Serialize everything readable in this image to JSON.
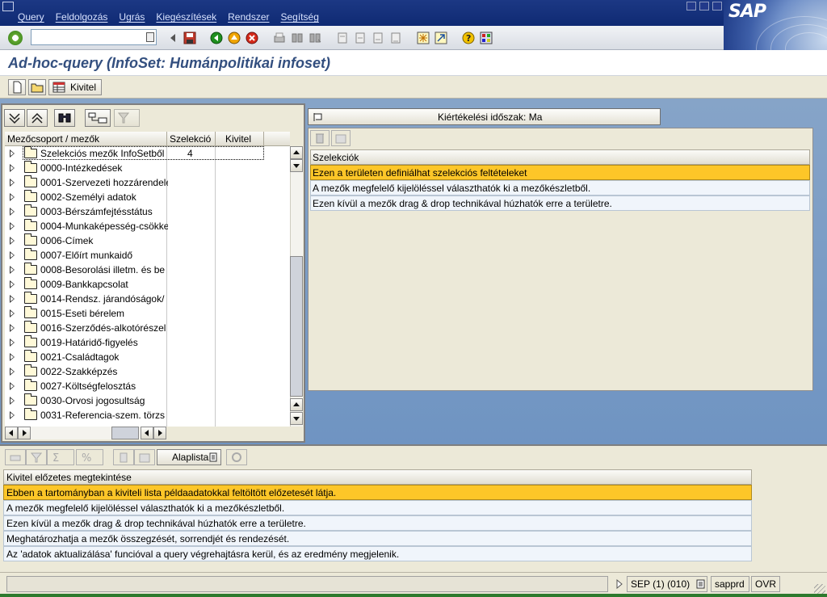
{
  "menubar": {
    "items": [
      "Query",
      "Feldolgozás",
      "Ugrás",
      "Kiegészítések",
      "Rendszer",
      "Segítség"
    ],
    "logo": "SAP"
  },
  "toolbar": {
    "command_field_value": "",
    "icons": [
      "enter-icon",
      "back-icon",
      "save-icon",
      "back-arrow-icon",
      "exit-icon",
      "cancel-icon",
      "print-icon",
      "find-icon",
      "find-next-icon",
      "first-page-icon",
      "prev-page-icon",
      "next-page-icon",
      "last-page-icon",
      "new-session-icon",
      "shortcut-icon",
      "help-icon",
      "layout-icon"
    ]
  },
  "title": "Ad-hoc-query (InfoSet: Humánpolitikai infoset)",
  "app_toolbar": {
    "kivitel_label": "Kivitel"
  },
  "tree": {
    "columns": [
      "Mezőcsoport / mezők",
      "Szelekció",
      "Kivitel"
    ],
    "rows": [
      {
        "label": "Szelekciós mezők InfoSetből",
        "selection": "4"
      },
      {
        "label": "0000-Intézkedések",
        "selection": ""
      },
      {
        "label": "0001-Szervezeti hozzárendelé",
        "selection": ""
      },
      {
        "label": "0002-Személyi adatok",
        "selection": ""
      },
      {
        "label": "0003-Bérszámfejtésstátus",
        "selection": ""
      },
      {
        "label": "0004-Munkaképesség-csökke",
        "selection": ""
      },
      {
        "label": "0006-Címek",
        "selection": ""
      },
      {
        "label": "0007-Előírt munkaidő",
        "selection": ""
      },
      {
        "label": "0008-Besorolási illetm. és be",
        "selection": ""
      },
      {
        "label": "0009-Bankkapcsolat",
        "selection": ""
      },
      {
        "label": "0014-Rendsz. járandóságok/",
        "selection": ""
      },
      {
        "label": "0015-Eseti bérelem",
        "selection": ""
      },
      {
        "label": "0016-Szerződés-alkotórészel",
        "selection": ""
      },
      {
        "label": "0019-Határidő-figyelés",
        "selection": ""
      },
      {
        "label": "0021-Családtagok",
        "selection": ""
      },
      {
        "label": "0022-Szakképzés",
        "selection": ""
      },
      {
        "label": "0027-Költségfelosztás",
        "selection": ""
      },
      {
        "label": "0030-Orvosi jogosultság",
        "selection": ""
      },
      {
        "label": "0031-Referencia-szem. törzs",
        "selection": ""
      }
    ]
  },
  "selection": {
    "period_button": "Kiértékelési időszak: Ma",
    "header": "Szelekciók",
    "rows": [
      {
        "text": "Ezen a területen definiálhat szelekciós feltételeket",
        "highlight": true
      },
      {
        "text": "A mezők megfelelő kijelöléssel választhatók ki a mezőkészletből.",
        "highlight": false
      },
      {
        "text": "Ezen kívül a mezők drag & drop technikával húzhatók erre a területre.",
        "highlight": false
      }
    ]
  },
  "output": {
    "alaplista_label": "Alaplista",
    "header": "Kivitel előzetes megtekintése",
    "rows": [
      {
        "text": "Ebben a tartományban a kiviteli lista példaadatokkal feltöltött előzetesét látja.",
        "highlight": true
      },
      {
        "text": "A mezők megfelelő kijelöléssel választhatók ki a mezőkészletből.",
        "highlight": false
      },
      {
        "text": "Ezen kívül a mezők drag & drop technikával húzhatók erre a területre.",
        "highlight": false
      },
      {
        "text": "Meghatározhatja a mezők összegzését, sorrendjét és rendezését.",
        "highlight": false
      },
      {
        "text": "Az 'adatok aktualizálása' funcióval a query végrehajtásra kerül, és az eredmény megjelenik.",
        "highlight": false
      }
    ]
  },
  "statusbar": {
    "system": "SEP (1) (010)",
    "server": "sapprd",
    "mode": "OVR"
  },
  "colors": {
    "highlight": "#fdc628",
    "title_text": "#334f7f",
    "menubar_bg": "#0f2a73",
    "main_bg": "#7a9cc4"
  }
}
